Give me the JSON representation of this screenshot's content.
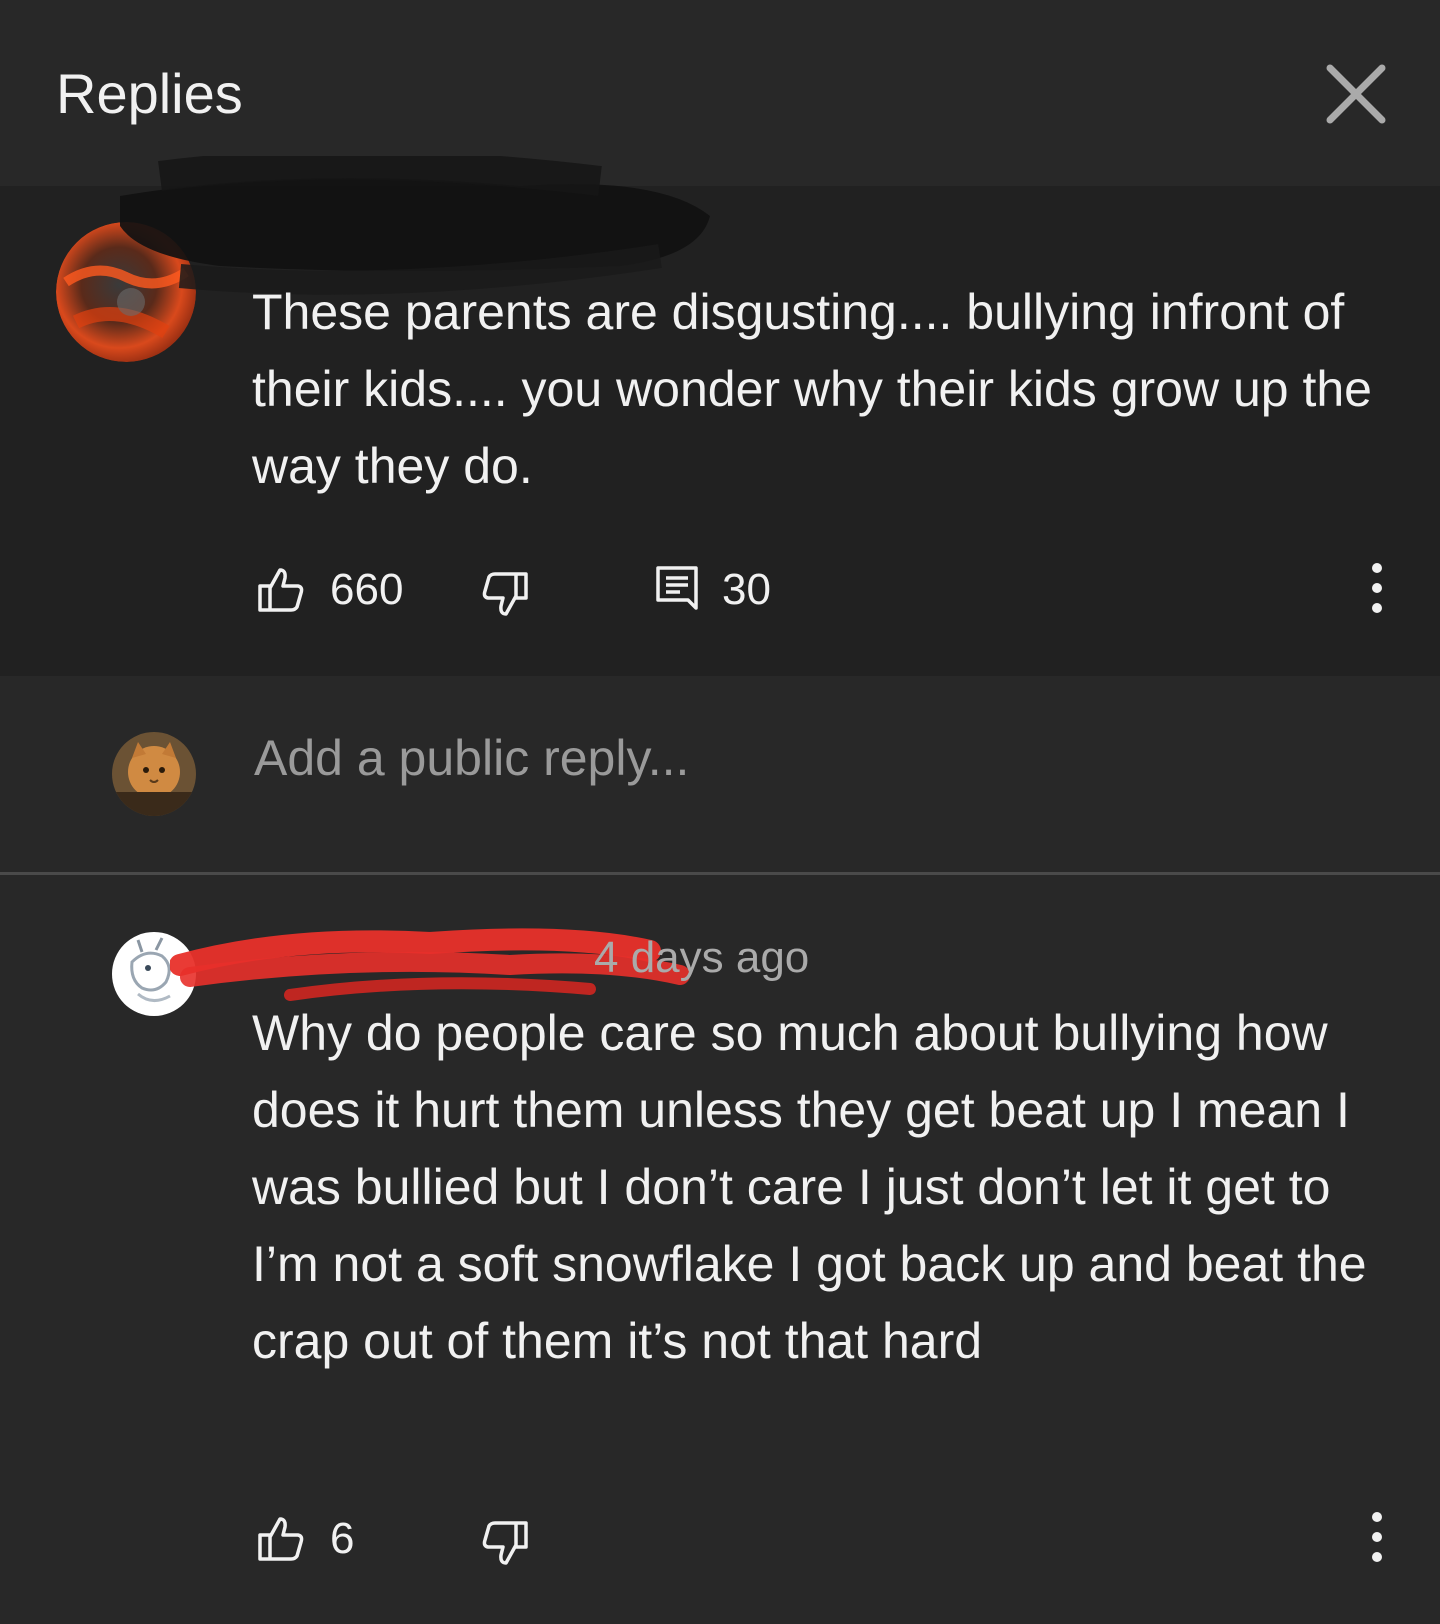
{
  "header": {
    "title": "Replies"
  },
  "parent_comment": {
    "text": "These parents are disgusting.... bullying infront of their kids.... you wonder why their kids grow up the way they do.",
    "likes": "660",
    "reply_count": "30"
  },
  "reply_box": {
    "placeholder": "Add a public reply..."
  },
  "reply": {
    "time": "4 days ago",
    "text": "Why do people care so much about bullying how does it hurt them unless they get beat up I mean I was bullied but I don’t care I just don’t let it get to I’m not a soft snowflake I got back up and beat the crap out of them it’s not that hard",
    "likes": "6"
  },
  "colors": {
    "background": "#282828",
    "highlighted_comment_bg": "#212121",
    "text": "#f1f1f1",
    "secondary_text": "#aaaaaa",
    "redaction_red": "#e8302a"
  }
}
